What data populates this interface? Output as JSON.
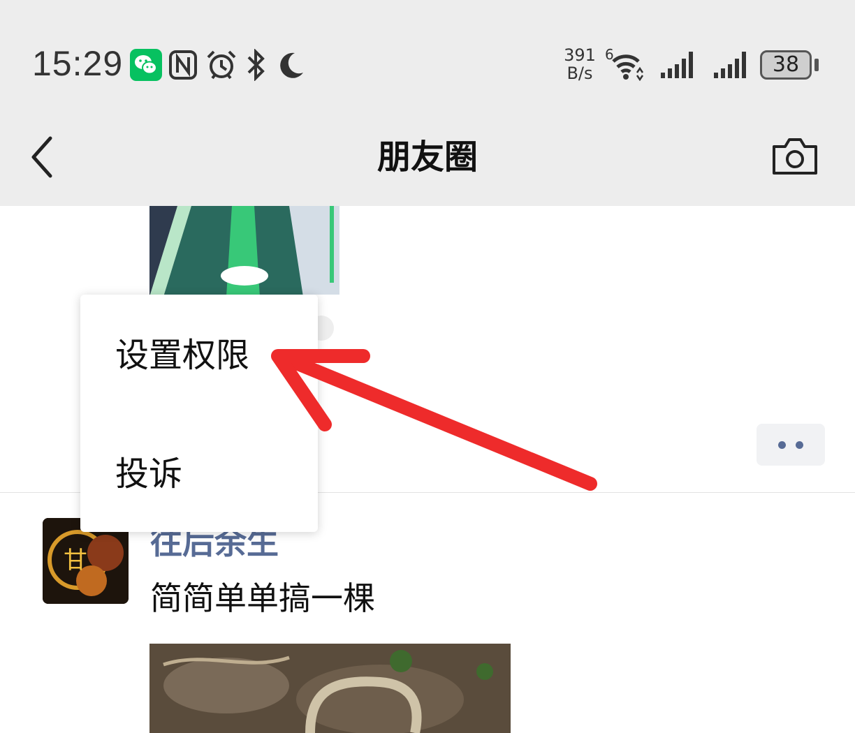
{
  "status_bar": {
    "time": "15:29",
    "net_speed_value": "391",
    "net_speed_unit": "B/s",
    "wifi_badge": "6",
    "battery": "38",
    "icons": [
      "wechat-icon",
      "nfc-icon",
      "alarm-icon",
      "bluetooth-icon",
      "moon-icon",
      "wifi-icon",
      "signal-icon",
      "signal-icon",
      "battery-icon"
    ]
  },
  "nav": {
    "title": "朋友圈",
    "back_icon": "chevron-left-icon",
    "camera_icon": "camera-icon"
  },
  "popup_menu": {
    "items": [
      {
        "label": "设置权限"
      },
      {
        "label": "投诉"
      }
    ]
  },
  "post": {
    "username": "往后余生",
    "text": "简简单单搞一棵"
  },
  "colors": {
    "header_bg": "#ededed",
    "username": "#576b95",
    "wechat_green": "#07c160",
    "annotation_arrow": "#ee2b2b"
  }
}
